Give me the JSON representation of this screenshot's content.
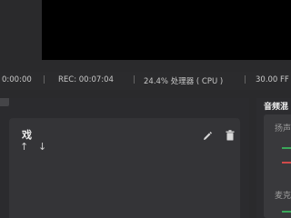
{
  "status": {
    "left_time": "0:00:00",
    "rec": "REC: 00:07:04",
    "cpu": "24.4% 处理器 ( CPU )",
    "fps": "30.00 FF",
    "sep": "|"
  },
  "sources_panel": {
    "title": "戏"
  },
  "audio_mixer": {
    "title": "音频混",
    "channels": [
      {
        "label": "扬声"
      },
      {
        "label": "麦克"
      }
    ]
  },
  "colors": {
    "meter_green": "#3aa85a",
    "meter_red": "#d04a4a"
  }
}
